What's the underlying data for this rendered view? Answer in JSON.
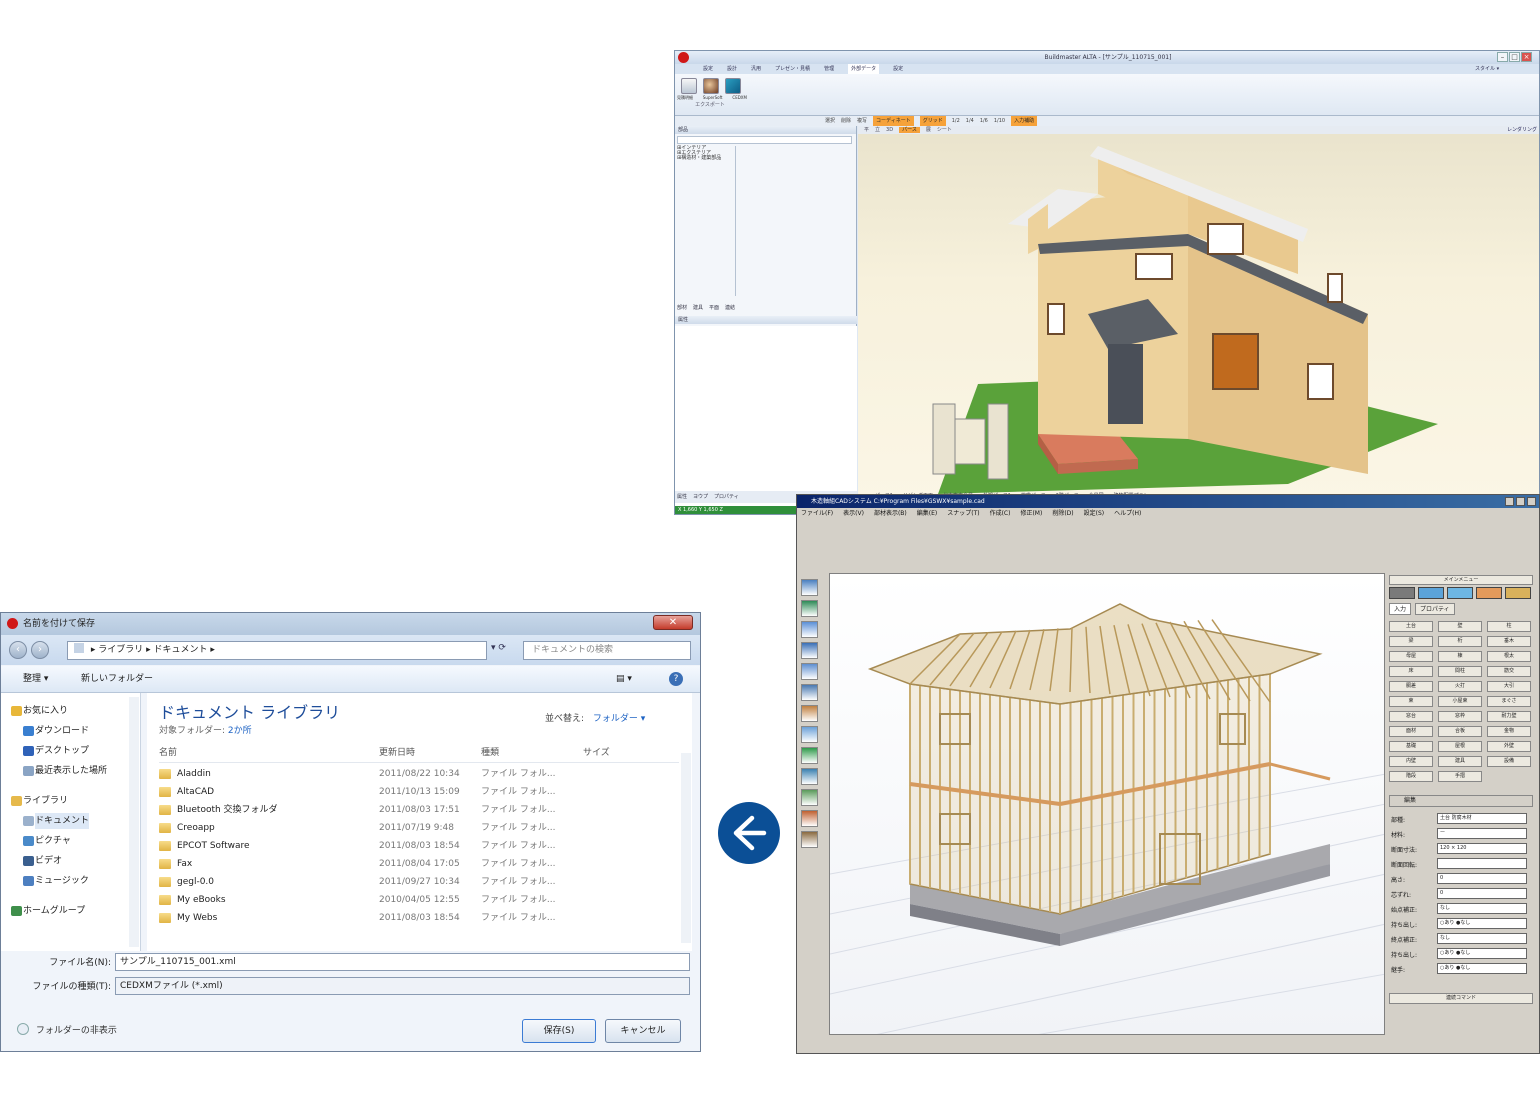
{
  "cad_window": {
    "title": "Buildmaster ALTA - [サンプル_110715_001]",
    "ribbon_tabs": [
      "設定",
      "設計",
      "汎用",
      "プレゼン・見積",
      "管理",
      "外部データ",
      "設定"
    ],
    "active_tab": "外部データ",
    "ribbon_buttons": [
      "見積明細",
      "SuperSoft",
      "CEDXM"
    ],
    "ribbon_group_label": "エクスポート",
    "style_label": "スタイル ▾",
    "toolbar_items": [
      "選択",
      "削除",
      "複写",
      "コーディネート",
      "グリッド",
      "1/2",
      "1/4",
      "1/6",
      "1/10",
      "入力補助"
    ],
    "left_panel_title": "部品",
    "tree_items": [
      "インテリア",
      "エクステリア",
      "構造材・建築部品"
    ],
    "left_tabs": [
      "部材",
      "建具",
      "平面",
      "連結"
    ],
    "properties_title": "属性",
    "view_tabs": [
      "平",
      "立",
      "3D",
      "パース",
      "展",
      "シート"
    ],
    "render_label": "レンダリング",
    "bottom_panel_items": [
      "属性",
      "ヨウプ",
      "プロパティ"
    ],
    "bottom_tabs": [
      "パース1",
      "リビング正面",
      "北東方向全景",
      "外観パース1",
      "俯瞰パース",
      "2階パース",
      "全景図",
      "建物配置プラン"
    ],
    "status": "X 1,660  Y 1,650  Z"
  },
  "frame_window": {
    "title": "木造軸組CADシステム  C:¥Program Files¥GSWX¥sample.cad",
    "menu": [
      "ファイル(F)",
      "表示(V)",
      "部材表示(B)",
      "編集(E)",
      "スナップ(T)",
      "作成(C)",
      "修正(M)",
      "削除(D)",
      "設定(S)",
      "ヘルプ(H)"
    ],
    "main_menu_label": "メインメニュー",
    "side_tabs": [
      "入力",
      "プロパティ"
    ],
    "side_buttons": [
      "土台",
      "壁",
      "柱",
      "梁",
      "桁",
      "垂木",
      "母屋",
      "棟",
      "根太",
      "床",
      "間柱",
      "筋交",
      "胴差",
      "火打",
      "大引",
      "束",
      "小屋束",
      "まぐさ",
      "窓台",
      "窓枠",
      "耐力壁",
      "面材",
      "合板",
      "金物",
      "基礎",
      "屋根",
      "外壁",
      "内壁",
      "建具",
      "設備",
      "階段",
      "手摺"
    ],
    "edit_label": "編集",
    "props": [
      {
        "label": "部種:",
        "value": "土台 防腐木材"
      },
      {
        "label": "材料:",
        "value": "ー"
      },
      {
        "label": "断面寸法:",
        "value": "120 × 120"
      },
      {
        "label": "断面回転:",
        "value": ""
      },
      {
        "label": "高さ:",
        "value": "0"
      },
      {
        "label": "芯ずれ:",
        "value": "0"
      },
      {
        "label": "始点補正:",
        "value": "なし"
      },
      {
        "label": "持ち出し:",
        "value": "○あり ●なし"
      },
      {
        "label": "終点補正:",
        "value": "なし"
      },
      {
        "label": "持ち出し:",
        "value": "○あり ●なし"
      },
      {
        "label": "継手:",
        "value": "○あり ●なし"
      }
    ],
    "bottom_button": "連続コマンド"
  },
  "dialog": {
    "title": "名前を付けて保存",
    "breadcrumb": "▸ ライブラリ ▸ ドキュメント ▸",
    "search_placeholder": "ドキュメントの検索",
    "organize": "整理 ▾",
    "new_folder": "新しいフォルダー",
    "library_title": "ドキュメント ライブラリ",
    "target_prefix": "対象フォルダー:",
    "target_count": "2か所",
    "arrange_label": "並べ替え:",
    "arrange_value": "フォルダー ▾",
    "columns": [
      "名前",
      "更新日時",
      "種類",
      "サイズ"
    ],
    "nav_items": [
      {
        "label": "お気に入り",
        "indent": 0,
        "color": "#e8b739"
      },
      {
        "label": "ダウンロード",
        "indent": 1,
        "color": "#3a7fd0"
      },
      {
        "label": "デスクトップ",
        "indent": 1,
        "color": "#2f62b8"
      },
      {
        "label": "最近表示した場所",
        "indent": 1,
        "color": "#8aa4c4"
      },
      {
        "label": "ライブラリ",
        "indent": 0,
        "color": "#e6b94b"
      },
      {
        "label": "ドキュメント",
        "indent": 1,
        "color": "#9bb1cc"
      },
      {
        "label": "ピクチャ",
        "indent": 1,
        "color": "#4a8ac9"
      },
      {
        "label": "ビデオ",
        "indent": 1,
        "color": "#3a5f8f"
      },
      {
        "label": "ミュージック",
        "indent": 1,
        "color": "#4d7fc0"
      },
      {
        "label": "ホームグループ",
        "indent": 0,
        "color": "#3f8f4b"
      }
    ],
    "files": [
      {
        "name": "Aladdin",
        "date": "2011/08/22 10:34",
        "type": "ファイル フォル..."
      },
      {
        "name": "AltaCAD",
        "date": "2011/10/13 15:09",
        "type": "ファイル フォル..."
      },
      {
        "name": "Bluetooth 交換フォルダ",
        "date": "2011/08/03 17:51",
        "type": "ファイル フォル..."
      },
      {
        "name": "Creoapp",
        "date": "2011/07/19 9:48",
        "type": "ファイル フォル..."
      },
      {
        "name": "EPCOT Software",
        "date": "2011/08/03 18:54",
        "type": "ファイル フォル..."
      },
      {
        "name": "Fax",
        "date": "2011/08/04 17:05",
        "type": "ファイル フォル..."
      },
      {
        "name": "gegl-0.0",
        "date": "2011/09/27 10:34",
        "type": "ファイル フォル..."
      },
      {
        "name": "My eBooks",
        "date": "2010/04/05 12:55",
        "type": "ファイル フォル..."
      },
      {
        "name": "My Webs",
        "date": "2011/08/03 18:54",
        "type": "ファイル フォル..."
      }
    ],
    "filename_label": "ファイル名(N):",
    "filename_value": "サンプル_110715_001.xml",
    "filetype_label": "ファイルの種類(T):",
    "filetype_value": "CEDXMファイル (*.xml)",
    "hide_folders": "フォルダーの非表示",
    "save_button": "保存(S)",
    "cancel_button": "キャンセル"
  },
  "colors": {
    "arrow": "#0b4f96",
    "wall": "#e9c98f",
    "roof": "#5a5f66",
    "grass": "#5aa23a",
    "deck": "#d97b5e",
    "timber": "#d8c08a"
  }
}
